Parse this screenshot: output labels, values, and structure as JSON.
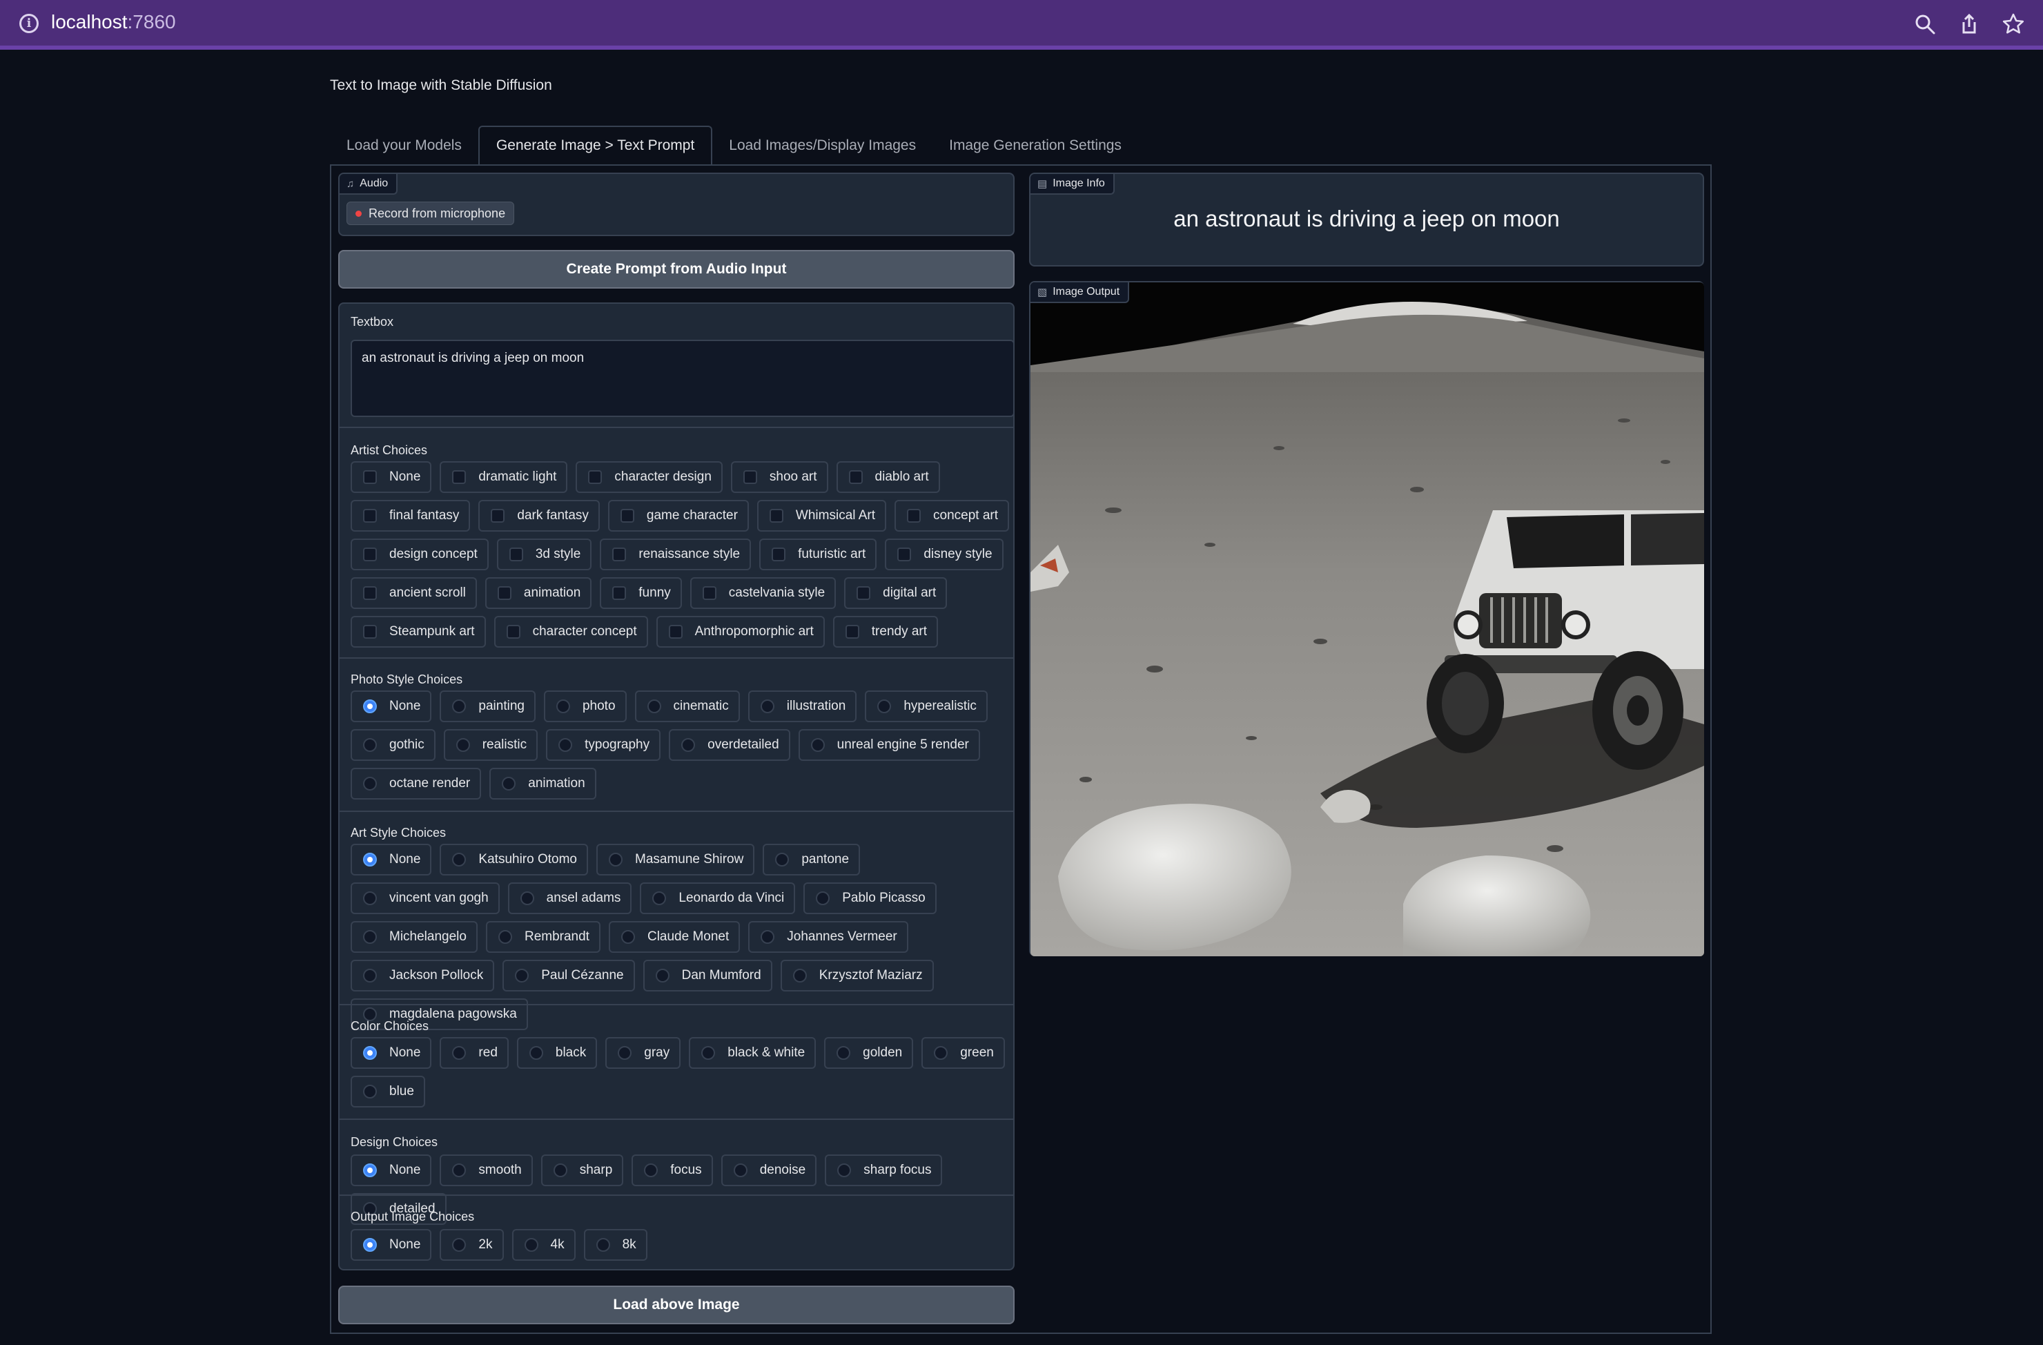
{
  "browser": {
    "url_host": "localhost",
    "url_port": ":7860"
  },
  "app": {
    "title": "Text to Image with Stable Diffusion"
  },
  "tabs": [
    {
      "label": "Load your Models",
      "active": false
    },
    {
      "label": "Generate Image > Text Prompt",
      "active": true
    },
    {
      "label": "Load Images/Display Images",
      "active": false
    },
    {
      "label": "Image Generation Settings",
      "active": false
    }
  ],
  "audio": {
    "label": "Audio",
    "record_label": "Record from microphone"
  },
  "create_prompt_button": "Create Prompt from Audio Input",
  "textbox": {
    "label": "Textbox",
    "value": "an astronaut is driving a jeep on moon"
  },
  "artist_choices": {
    "label": "Artist Choices",
    "options": [
      "None",
      "dramatic light",
      "character design",
      "shoo art",
      "diablo art",
      "final fantasy",
      "dark fantasy",
      "game character",
      "Whimsical Art",
      "concept art",
      "design concept",
      "3d style",
      "renaissance style",
      "futuristic art",
      "disney style",
      "ancient scroll",
      "animation",
      "funny",
      "castelvania style",
      "digital art",
      "Steampunk art",
      "character concept",
      "Anthropomorphic art",
      "trendy art"
    ]
  },
  "photo_style_choices": {
    "label": "Photo Style Choices",
    "selected": "None",
    "options": [
      "None",
      "painting",
      "photo",
      "cinematic",
      "illustration",
      "hyperealistic",
      "gothic",
      "realistic",
      "typography",
      "overdetailed",
      "unreal engine 5 render",
      "octane render",
      "animation"
    ]
  },
  "art_style_choices": {
    "label": "Art Style Choices",
    "selected": "None",
    "options": [
      "None",
      "Katsuhiro Otomo",
      "Masamune Shirow",
      "pantone",
      "vincent van gogh",
      "ansel adams",
      "Leonardo da Vinci",
      "Pablo Picasso",
      "Michelangelo",
      "Rembrandt",
      "Claude Monet",
      "Johannes Vermeer",
      "Jackson Pollock",
      "Paul Cézanne",
      "Dan Mumford",
      "Krzysztof Maziarz",
      "magdalena pagowska"
    ]
  },
  "color_choices": {
    "label": "Color Choices",
    "selected": "None",
    "options": [
      "None",
      "red",
      "black",
      "gray",
      "black & white",
      "golden",
      "green",
      "blue"
    ]
  },
  "design_choices": {
    "label": "Design Choices",
    "selected": "None",
    "options": [
      "None",
      "smooth",
      "sharp",
      "focus",
      "denoise",
      "sharp focus",
      "detailed"
    ]
  },
  "output_image_choices": {
    "label": "Output Image Choices",
    "selected": "None",
    "options": [
      "None",
      "2k",
      "4k",
      "8k"
    ]
  },
  "load_button": "Load above Image",
  "image_info": {
    "label": "Image Info",
    "text": "an astronaut is driving a jeep on moon"
  },
  "image_output": {
    "label": "Image Output"
  },
  "icons": [
    "info-icon",
    "zoom-icon",
    "share-icon",
    "star-icon",
    "music-icon",
    "image-icon"
  ]
}
